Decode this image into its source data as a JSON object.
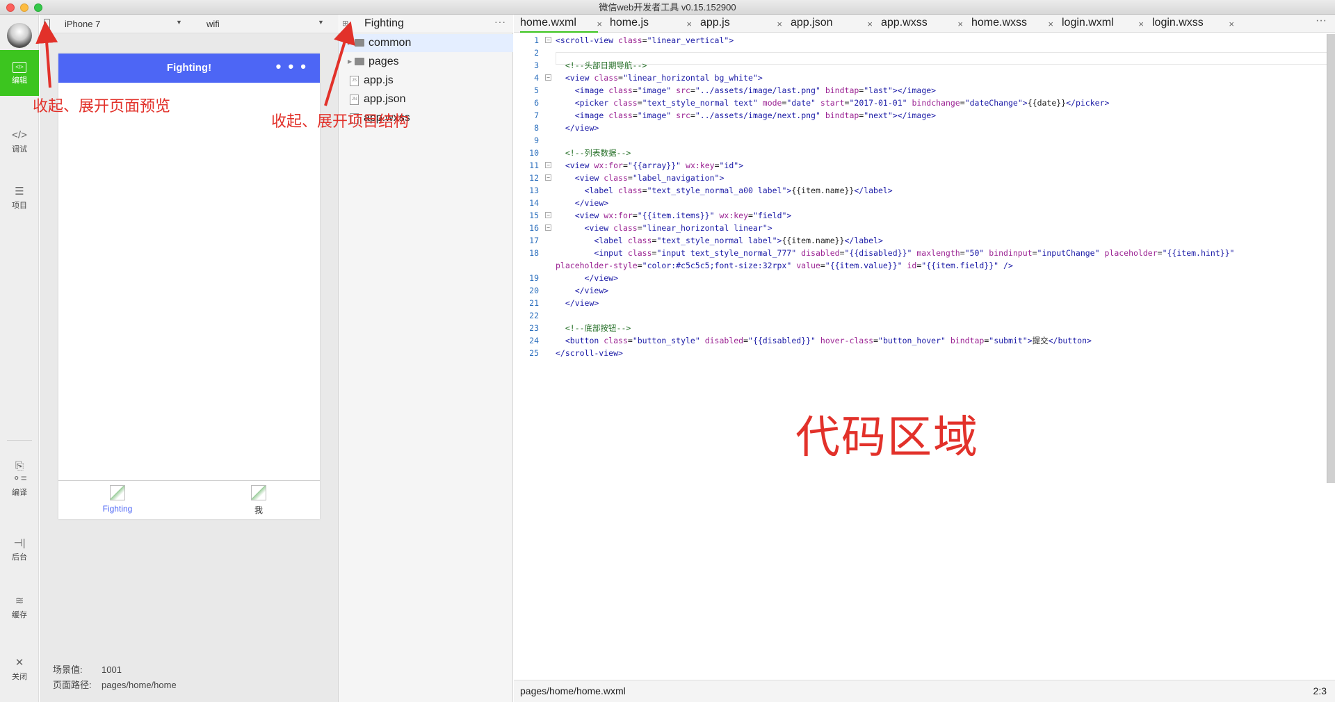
{
  "window": {
    "title": "微信web开发者工具 v0.15.152900"
  },
  "sidebar": {
    "items": [
      {
        "label": "编辑",
        "icon": "code-editor-icon"
      },
      {
        "label": "调试",
        "icon": "debug-icon"
      },
      {
        "label": "项目",
        "icon": "project-list-icon"
      },
      {
        "label": "编译",
        "icon": "compile-icon"
      },
      {
        "label": "后台",
        "icon": "background-icon"
      },
      {
        "label": "缓存",
        "icon": "cache-layers-icon"
      },
      {
        "label": "关闭",
        "icon": "close-icon"
      }
    ]
  },
  "simulator": {
    "device": "iPhone 7",
    "network": "wifi",
    "nav_title": "Fighting!",
    "nav_more": "• • •",
    "tabs": [
      {
        "label": "Fighting",
        "color": "#4d66f5"
      },
      {
        "label": "我",
        "color": "#333333"
      }
    ],
    "scene_label": "场景值:",
    "scene_value": "1001",
    "path_label": "页面路径:",
    "path_value": "pages/home/home"
  },
  "project": {
    "name": "Fighting",
    "more": "···",
    "tree": [
      {
        "type": "folder",
        "label": "common"
      },
      {
        "type": "folder",
        "label": "pages"
      },
      {
        "type": "file",
        "label": "app.js",
        "badge": "JS"
      },
      {
        "type": "file",
        "label": "app.json",
        "badge": "JN"
      },
      {
        "type": "file",
        "label": "app.wxss",
        "badge": ""
      }
    ]
  },
  "editor": {
    "tabs": [
      "home.wxml",
      "home.js",
      "app.js",
      "app.json",
      "app.wxss",
      "home.wxss",
      "login.wxml",
      "login.wxss"
    ],
    "active_tab": "home.wxml",
    "tab_more": "···",
    "status_path": "pages/home/home.wxml",
    "cursor": "2:3",
    "lines": [
      {
        "n": "1",
        "fold": true,
        "html": "<span class=\"tg\">&lt;scroll-view</span> <span class=\"at\">class</span>=<span class=\"st\">\"linear_vertical\"</span><span class=\"tg\">&gt;</span>"
      },
      {
        "n": "2",
        "fold": false,
        "html": ""
      },
      {
        "n": "3",
        "fold": false,
        "html": "  <span class=\"cm\">&lt;!--头部日期导航--&gt;</span>"
      },
      {
        "n": "4",
        "fold": true,
        "html": "  <span class=\"tg\">&lt;view</span> <span class=\"at\">class</span>=<span class=\"st\">\"linear_horizontal bg_white\"</span><span class=\"tg\">&gt;</span>"
      },
      {
        "n": "5",
        "fold": false,
        "html": "    <span class=\"tg\">&lt;image</span> <span class=\"at\">class</span>=<span class=\"st\">\"image\"</span> <span class=\"at\">src</span>=<span class=\"st\">\"../assets/image/last.png\"</span> <span class=\"at\">bindtap</span>=<span class=\"st\">\"last\"</span><span class=\"tg\">&gt;&lt;/image&gt;</span>"
      },
      {
        "n": "6",
        "fold": false,
        "html": "    <span class=\"tg\">&lt;picker</span> <span class=\"at\">class</span>=<span class=\"st\">\"text_style_normal text\"</span> <span class=\"at\">mode</span>=<span class=\"st\">\"date\"</span> <span class=\"at\">start</span>=<span class=\"st\">\"2017-01-01\"</span> <span class=\"at\">bindchange</span>=<span class=\"st\">\"dateChange\"</span><span class=\"tg\">&gt;</span>{{date}}<span class=\"tg\">&lt;/picker&gt;</span>"
      },
      {
        "n": "7",
        "fold": false,
        "html": "    <span class=\"tg\">&lt;image</span> <span class=\"at\">class</span>=<span class=\"st\">\"image\"</span> <span class=\"at\">src</span>=<span class=\"st\">\"../assets/image/next.png\"</span> <span class=\"at\">bindtap</span>=<span class=\"st\">\"next\"</span><span class=\"tg\">&gt;&lt;/image&gt;</span>"
      },
      {
        "n": "8",
        "fold": false,
        "html": "  <span class=\"tg\">&lt;/view&gt;</span>"
      },
      {
        "n": "9",
        "fold": false,
        "html": ""
      },
      {
        "n": "10",
        "fold": false,
        "html": "  <span class=\"cm\">&lt;!--列表数据--&gt;</span>"
      },
      {
        "n": "11",
        "fold": true,
        "html": "  <span class=\"tg\">&lt;view</span> <span class=\"at\">wx:for</span>=<span class=\"st\">\"{{array}}\"</span> <span class=\"at\">wx:key</span>=<span class=\"st\">\"id\"</span><span class=\"tg\">&gt;</span>"
      },
      {
        "n": "12",
        "fold": true,
        "html": "    <span class=\"tg\">&lt;view</span> <span class=\"at\">class</span>=<span class=\"st\">\"label_navigation\"</span><span class=\"tg\">&gt;</span>"
      },
      {
        "n": "13",
        "fold": false,
        "html": "      <span class=\"tg\">&lt;label</span> <span class=\"at\">class</span>=<span class=\"st\">\"text_style_normal_a00 label\"</span><span class=\"tg\">&gt;</span>{{item.name}}<span class=\"tg\">&lt;/label&gt;</span>"
      },
      {
        "n": "14",
        "fold": false,
        "html": "    <span class=\"tg\">&lt;/view&gt;</span>"
      },
      {
        "n": "15",
        "fold": true,
        "html": "    <span class=\"tg\">&lt;view</span> <span class=\"at\">wx:for</span>=<span class=\"st\">\"{{item.items}}\"</span> <span class=\"at\">wx:key</span>=<span class=\"st\">\"field\"</span><span class=\"tg\">&gt;</span>"
      },
      {
        "n": "16",
        "fold": true,
        "html": "      <span class=\"tg\">&lt;view</span> <span class=\"at\">class</span>=<span class=\"st\">\"linear_horizontal linear\"</span><span class=\"tg\">&gt;</span>"
      },
      {
        "n": "17",
        "fold": false,
        "html": "        <span class=\"tg\">&lt;label</span> <span class=\"at\">class</span>=<span class=\"st\">\"text_style_normal label\"</span><span class=\"tg\">&gt;</span>{{item.name}}<span class=\"tg\">&lt;/label&gt;</span>"
      },
      {
        "n": "18",
        "fold": false,
        "html": "        <span class=\"tg\">&lt;input</span> <span class=\"at\">class</span>=<span class=\"st\">\"input text_style_normal_777\"</span> <span class=\"at\">disabled</span>=<span class=\"st\">\"{{disabled}}\"</span> <span class=\"at\">maxlength</span>=<span class=\"st\">\"50\"</span> <span class=\"at\">bindinput</span>=<span class=\"st\">\"inputChange\"</span> <span class=\"at\">placeholder</span>=<span class=\"st\">\"{{item.hint}}\"</span>"
      },
      {
        "n": "",
        "fold": false,
        "html": "<span class=\"at\">placeholder-style</span>=<span class=\"st\">\"color:#c5c5c5;font-size:32rpx\"</span> <span class=\"at\">value</span>=<span class=\"st\">\"{{item.value}}\"</span> <span class=\"at\">id</span>=<span class=\"st\">\"{{item.field}}\"</span> <span class=\"tg\">/&gt;</span>"
      },
      {
        "n": "19",
        "fold": false,
        "html": "      <span class=\"tg\">&lt;/view&gt;</span>"
      },
      {
        "n": "20",
        "fold": false,
        "html": "    <span class=\"tg\">&lt;/view&gt;</span>"
      },
      {
        "n": "21",
        "fold": false,
        "html": "  <span class=\"tg\">&lt;/view&gt;</span>"
      },
      {
        "n": "22",
        "fold": false,
        "html": ""
      },
      {
        "n": "23",
        "fold": false,
        "html": "  <span class=\"cm\">&lt;!--底部按钮--&gt;</span>"
      },
      {
        "n": "24",
        "fold": false,
        "html": "  <span class=\"tg\">&lt;button</span> <span class=\"at\">class</span>=<span class=\"st\">\"button_style\"</span> <span class=\"at\">disabled</span>=<span class=\"st\">\"{{disabled}}\"</span> <span class=\"at\">hover-class</span>=<span class=\"st\">\"button_hover\"</span> <span class=\"at\">bindtap</span>=<span class=\"st\">\"submit\"</span><span class=\"tg\">&gt;</span>提交<span class=\"tg\">&lt;/button&gt;</span>"
      },
      {
        "n": "25",
        "fold": false,
        "html": "<span class=\"tg\">&lt;/scroll-view&gt;</span>"
      }
    ]
  },
  "annotations": {
    "preview_toggle": "收起、展开页面预览",
    "tree_toggle": "收起、展开项目结构",
    "code_area": "代码区域",
    "color": "#e2312a"
  },
  "colors": {
    "accent": "#3cc51f",
    "nav": "#4d66f5"
  }
}
